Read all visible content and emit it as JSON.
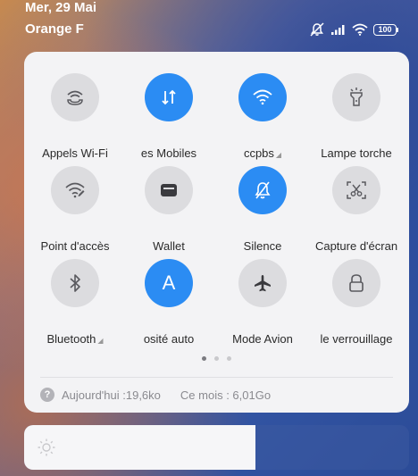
{
  "status_bar": {
    "date": "Mer, 29 Mai",
    "carrier": "Orange F",
    "battery": "100"
  },
  "tiles": [
    {
      "label": "Appels Wi-Fi",
      "active": false,
      "icon": "wifi-calling-icon"
    },
    {
      "label": "es Mobiles",
      "active": true,
      "icon": "mobile-data-icon"
    },
    {
      "label": "ccpbs",
      "active": true,
      "icon": "wifi-icon",
      "expand": true
    },
    {
      "label": "Lampe torche",
      "active": false,
      "icon": "flashlight-icon"
    },
    {
      "label": "Point d'accès",
      "active": false,
      "icon": "hotspot-icon"
    },
    {
      "label": "Wallet",
      "active": false,
      "icon": "wallet-icon"
    },
    {
      "label": "Silence",
      "active": true,
      "icon": "bell-off-icon"
    },
    {
      "label": "Capture d'écran",
      "active": false,
      "icon": "screenshot-icon"
    },
    {
      "label": "Bluetooth",
      "active": false,
      "icon": "bluetooth-icon",
      "expand": true
    },
    {
      "label": "osité auto",
      "active": true,
      "icon": "auto-brightness-icon",
      "glyph": "A"
    },
    {
      "label": "Mode Avion",
      "active": false,
      "icon": "airplane-icon"
    },
    {
      "label": "le verrouillage",
      "active": false,
      "icon": "lock-icon"
    }
  ],
  "page_indicator": {
    "pages": 3,
    "current": 1
  },
  "usage": {
    "today": "Aujourd'hui :19,6ko",
    "month": "Ce mois : 6,01Go"
  },
  "brightness": {
    "level": 0.6
  },
  "colors": {
    "active": "#2b8cf3",
    "inactive": "#dcdcdf",
    "panel": "#f3f3f5"
  }
}
